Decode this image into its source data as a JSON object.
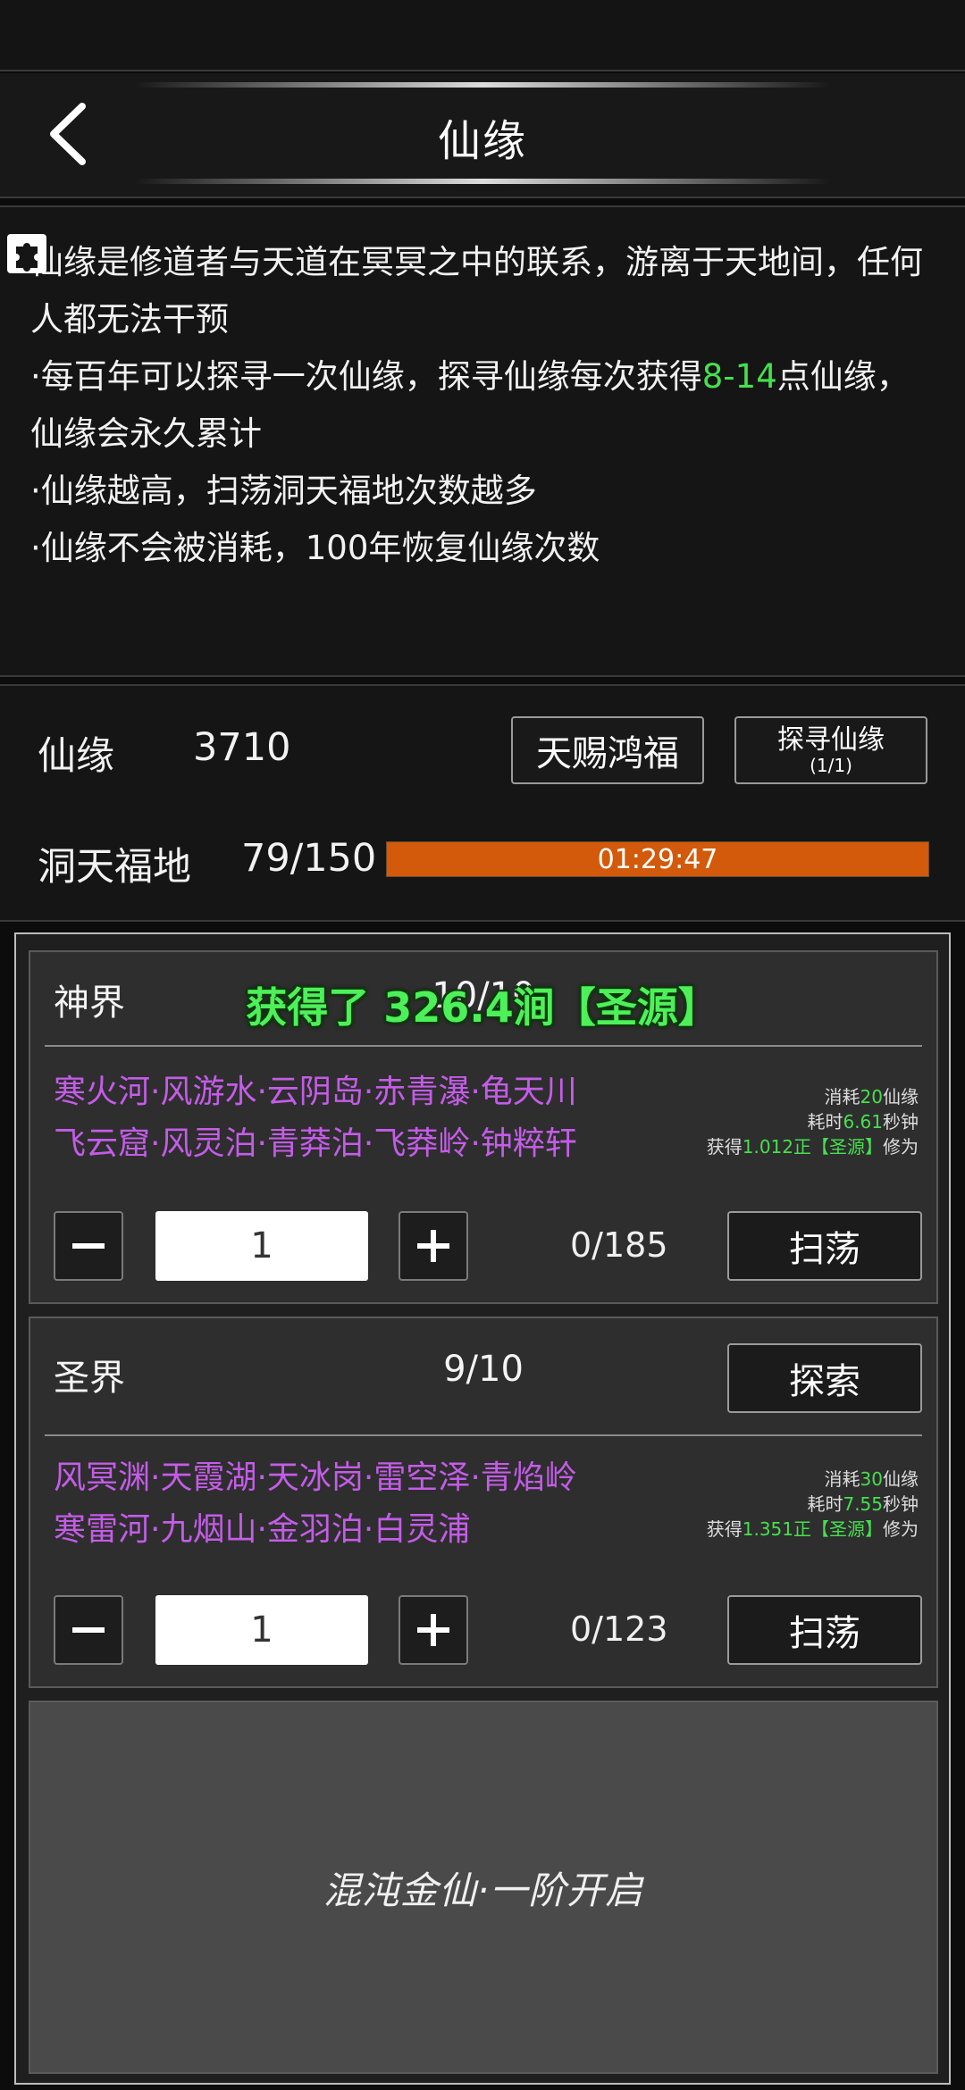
{
  "header": {
    "title": "仙缘",
    "back_icon": "chevron-left-icon"
  },
  "description": {
    "line1": "仙缘是修道者与天道在冥冥之中的联系，游离于天地间，任何人都无法干预",
    "line2_pre": "·每百年可以探寻一次仙缘，探寻仙缘每次获得",
    "line2_hl": "8-14",
    "line2_post": "点仙缘，仙缘会永久累计",
    "line3": "·仙缘越高，扫荡洞天福地次数越多",
    "line4": "·仙缘不会被消耗，100年恢复仙缘次数",
    "colors": {
      "highlight": "#45e04e"
    }
  },
  "stats": {
    "xianyuan_label": "仙缘",
    "xianyuan_value": "3710",
    "tianci_button": "天赐鸿福",
    "tanxun_button": "探寻仙缘",
    "tanxun_sub": "(1/1)",
    "dongtian_label": "洞天福地",
    "dongtian_value": "79/150",
    "dongtian_fraction": 0.527,
    "timer": "01:29:47",
    "colors": {
      "progress": "#d25a0a"
    }
  },
  "toast": "获得了 326.4涧【圣源】",
  "realms": [
    {
      "name": "神界",
      "count": "10/10",
      "places_line1": "寒火河·风游水·云阴岛·赤青瀑·龟天川",
      "places_line2": "飞云窟·风灵泊·青莽泊·飞莽岭·钟粹轩",
      "cost_pre": "消耗",
      "cost_value": "20",
      "cost_post": "仙缘",
      "time_pre": "耗时",
      "time_value": "6.61",
      "time_post": "秒钟",
      "gain_pre": "获得",
      "gain_value": "1.012正",
      "gain_mid": "【圣源】",
      "gain_post": "修为",
      "quantity": "1",
      "sweep_count": "0/185",
      "sweep_button": "扫荡"
    },
    {
      "name": "圣界",
      "count": "9/10",
      "explore_button": "探索",
      "places_line1": "风冥渊·天霞湖·天冰岗·雷空泽·青焰岭",
      "places_line2": "寒雷河·九烟山·金羽泊·白灵浦",
      "cost_pre": "消耗",
      "cost_value": "30",
      "cost_post": "仙缘",
      "time_pre": "耗时",
      "time_value": "7.55",
      "time_post": "秒钟",
      "gain_pre": "获得",
      "gain_value": "1.351正",
      "gain_mid": "【圣源】",
      "gain_post": "修为",
      "quantity": "1",
      "sweep_count": "0/123",
      "sweep_button": "扫荡"
    }
  ],
  "locked_realm": {
    "text": "混沌金仙·一阶开启"
  },
  "colors": {
    "place_text": "#c45ce8",
    "value_green": "#45e04e",
    "toast": "#4ef05a"
  }
}
